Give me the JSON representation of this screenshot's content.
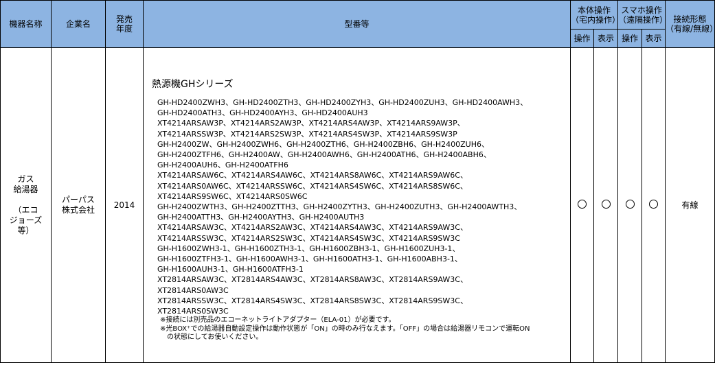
{
  "headers": {
    "device_name": "機器名称",
    "company": "企業名",
    "release_year": "発売\n年度",
    "model": "型番等",
    "body_op": "本体操作\n（宅内操作）",
    "phone_op": "スマホ操作\n（遠隔操作）",
    "connection": "接続形態\n（有線/無線）",
    "operate": "操作",
    "display": "表示"
  },
  "row": {
    "device_name": "ガス\n給湯器\n\n（エコ\nジョーズ\n等）",
    "company": "パーパス\n株式会社",
    "year": "2014",
    "series_title": "熱源機GHシリーズ",
    "model_lines": [
      "GH-HD2400ZWH3、GH-HD2400ZTH3、GH-HD2400ZYH3、GH-HD2400ZUH3、GH-HD2400AWH3、",
      "GH-HD2400ATH3、GH-HD2400AYH3、GH-HD2400AUH3",
      "XT4214ARSAW3P、XT4214ARS2AW3P、XT4214ARS4AW3P、XT4214ARS9AW3P、",
      "XT4214ARSSW3P、XT4214ARS2SW3P、XT4214ARS4SW3P、XT4214ARS9SW3P",
      "GH-H2400ZW、GH-H2400ZWH6、GH-H2400ZTH6、GH-H2400ZBH6、GH-H2400ZUH6、",
      "GH-H2400ZTFH6、GH-H2400AW、GH-H2400AWH6、GH-H2400ATH6、GH-H2400ABH6、",
      "GH-H2400AUH6、GH-H2400ATFH6",
      "XT4214ARSAW6C、XT4214ARS4AW6C、XT4214ARS8AW6C、XT4214ARS9AW6C、",
      "XT4214ARS0AW6C、XT4214ARSSW6C、XT4214ARS4SW6C、XT4214ARS8SW6C、",
      "XT4214ARS9SW6C、XT4214ARS0SW6C",
      "GH-H2400ZWTH3、GH-H2400ZTTH3、GH-H2400ZYTH3、GH-H2400ZUTH3、GH-H2400AWTH3、",
      "GH-H2400ATTH3、GH-H2400AYTH3、GH-H2400AUTH3",
      "XT4214ARSAW3C、XT4214ARS2AW3C、XT4214ARS4AW3C、XT4214ARS9AW3C、",
      "XT4214ARSSW3C、XT4214ARS2SW3C、XT4214ARS4SW3C、XT4214ARS9SW3C",
      "GH-H1600ZWH3-1、GH-H1600ZTH3-1、GH-H1600ZBH3-1、GH-H1600ZUH3-1、",
      "GH-H1600ZTFH3-1、GH-H1600AWH3-1、GH-H1600ATH3-1、GH-H1600ABH3-1、",
      "GH-H1600AUH3-1、GH-H1600ATFH3-1",
      "XT2814ARSAW3C、XT2814ARS4AW3C、XT2814ARS8AW3C、XT2814ARS9AW3C、",
      "XT2814ARS0AW3C",
      "XT2814ARSSW3C、XT2814ARS4SW3C、XT2814ARS8SW3C、XT2814ARS9SW3C、",
      "XT2814ARS0SW3C"
    ],
    "note1": "※接続には別売品のエコーネットライトアダプター（ELA-01）が必要です。",
    "note2": "※光BOX⁺での給湯器自動設定操作は動作状態が「ON」の時のみ行なえます。「OFF」の場合は給湯器リモコンで運転ON\n　の状態にしてお使いください。",
    "connection": "有線"
  },
  "icons": {
    "support_mark": "circle-outline-icon"
  },
  "colors": {
    "header_bg": "#8db4e2",
    "border": "#000000"
  }
}
